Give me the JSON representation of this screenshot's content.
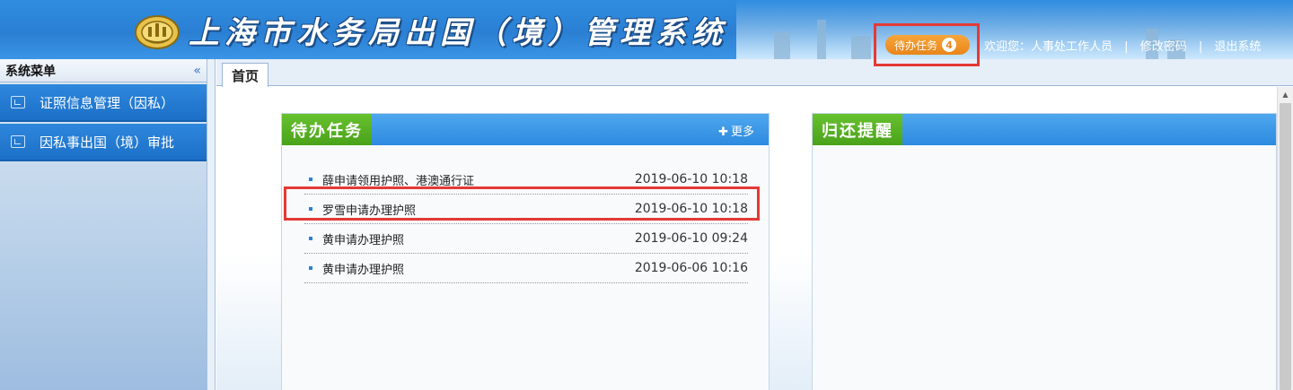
{
  "header": {
    "title": "上海市水务局出国（境）管理系统",
    "todo_label": "待办任务",
    "todo_count": "4",
    "welcome": "欢迎您：人事处工作人员",
    "change_password": "修改密码",
    "logout": "退出系统",
    "separator": "|"
  },
  "sidebar": {
    "title": "系统菜单",
    "collapse_glyph": "«",
    "items": [
      {
        "label": "证照信息管理（因私）",
        "icon": "image-icon"
      },
      {
        "label": "因私事出国（境）审批",
        "icon": "edit-icon"
      }
    ]
  },
  "tabs": [
    {
      "label": "首页"
    }
  ],
  "panels": {
    "todo": {
      "title": "待办任务",
      "more": "更多",
      "tasks": [
        {
          "name": "薛申请领用护照、港澳通行证",
          "time": "2019-06-10 10:18"
        },
        {
          "name": "罗雪申请办理护照",
          "time": "2019-06-10 10:18"
        },
        {
          "name": "黄申请办理护照",
          "time": "2019-06-10 09:24"
        },
        {
          "name": "黄申请办理护照",
          "time": "2019-06-06 10:16"
        }
      ]
    },
    "return_reminder": {
      "title": "归还提醒"
    }
  },
  "colors": {
    "header_blue": "#2a7fd3",
    "panel_green": "#4aa21a",
    "badge_orange": "#e8861a",
    "annotation_red": "#e53935"
  }
}
